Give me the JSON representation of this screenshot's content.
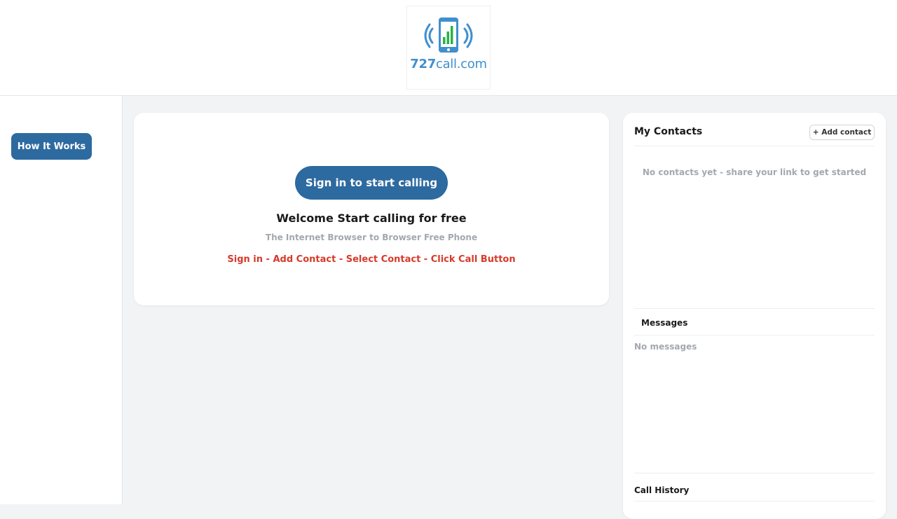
{
  "header": {
    "logo": {
      "number": "727",
      "suffix": "call.com",
      "icon": "phone-signal-icon",
      "colors": {
        "phone": "#3f8fcf",
        "bars": "#2bb14a"
      }
    }
  },
  "sidebar": {
    "how_it_works_label": "How It Works"
  },
  "main": {
    "signin_label": "Sign in to start calling",
    "welcome": "Welcome Start calling for free",
    "tagline": "The Internet Browser to Browser Free Phone",
    "steps": "Sign in - Add Contact - Select Contact - Click Call Button"
  },
  "contacts": {
    "title": "My Contacts",
    "add_label": "+ Add contact",
    "empty_text": "No contacts yet - share your link to get started"
  },
  "messages": {
    "title": "Messages",
    "empty_text": "No messages"
  },
  "call_history": {
    "title": "Call History"
  },
  "colors": {
    "primary": "#2d6aa0",
    "accent_red": "#d63a2a",
    "muted": "#a3a8b0",
    "background": "#f2f3f5"
  }
}
